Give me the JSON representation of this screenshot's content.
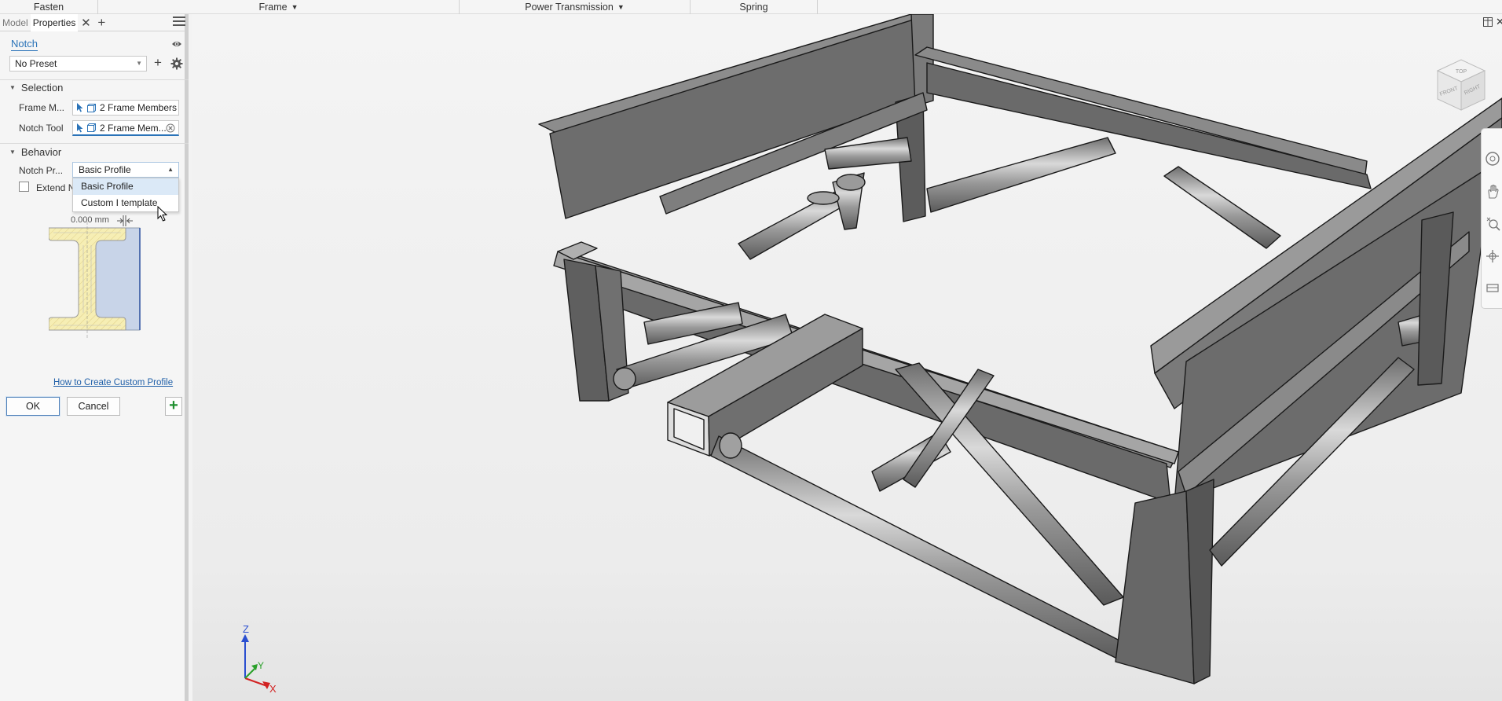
{
  "ribbon": {
    "groups": [
      {
        "label": "Fasten",
        "dropdown": false
      },
      {
        "label": "Frame",
        "dropdown": true
      },
      {
        "label": "Power Transmission",
        "dropdown": true
      },
      {
        "label": "Spring",
        "dropdown": false
      }
    ]
  },
  "panel": {
    "tabs": {
      "model": "Model",
      "properties": "Properties"
    },
    "command_name": "Notch",
    "preset": {
      "value": "No Preset"
    },
    "selection": {
      "header": "Selection",
      "frame_members_label": "Frame M...",
      "frame_members_value": "2 Frame Members",
      "notch_tool_label": "Notch Tool",
      "notch_tool_value": "2 Frame Mem..."
    },
    "behavior": {
      "header": "Behavior",
      "notch_profile_label": "Notch Pr...",
      "notch_profile_value": "Basic Profile",
      "options": [
        "Basic Profile",
        "Custom I template"
      ],
      "extend_label": "Extend Notch",
      "extend_checked": false,
      "offset_value": "0.000 mm"
    },
    "help_link": "How to Create Custom Profile",
    "buttons": {
      "ok": "OK",
      "cancel": "Cancel"
    }
  },
  "viewport": {
    "triad": {
      "x": "X",
      "y": "Y",
      "z": "Z"
    },
    "view_cube": {
      "top": "TOP",
      "front": "FRONT",
      "right": "RIGHT"
    }
  },
  "colors": {
    "accent": "#2a73b8",
    "link": "#1f5fa8",
    "add_green": "#1e8f2e",
    "profile_fill": "#f6eeb4",
    "notch_fill": "#c8d4e8",
    "axis_x": "#d22222",
    "axis_y": "#2aa02a",
    "axis_z": "#2a4fd0"
  },
  "icons": [
    "eye-icon",
    "gear-icon",
    "hamburger-icon",
    "close-icon",
    "add-icon",
    "select-arrow-icon",
    "frame-cube-icon",
    "clear-icon",
    "pan-icon",
    "zoom-icon",
    "orbit-icon",
    "look-at-icon",
    "steering-wheel-icon",
    "view-cube-icon",
    "split-view-icon"
  ]
}
